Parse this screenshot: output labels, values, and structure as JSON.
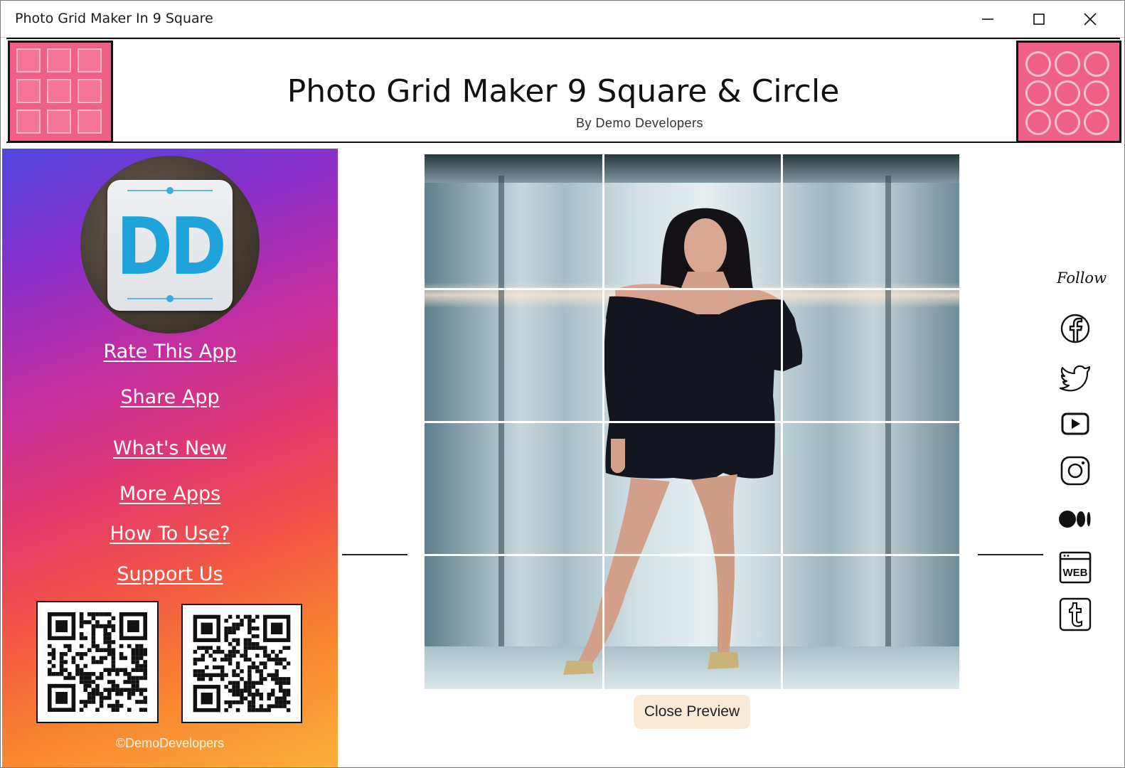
{
  "window": {
    "title": "Photo Grid Maker In 9 Square"
  },
  "header": {
    "title": "Photo Grid Maker 9 Square & Circle",
    "subtitle": "By  Demo  Developers"
  },
  "sidebar": {
    "avatar_text": "DD",
    "links": [
      {
        "id": "rate",
        "label": "Rate This App"
      },
      {
        "id": "share",
        "label": "Share App"
      },
      {
        "id": "whats-new",
        "label": "What's New"
      },
      {
        "id": "more-apps",
        "label": "More Apps"
      },
      {
        "id": "how-to-use",
        "label": "How To Use?"
      },
      {
        "id": "support",
        "label": "Support Us"
      }
    ],
    "copyright": "©DemoDevelopers"
  },
  "preview": {
    "grid": "3x4",
    "close_label": "Close Preview"
  },
  "follow": {
    "label": "Follow",
    "icons": [
      "facebook-icon",
      "twitter-icon",
      "youtube-icon",
      "instagram-icon",
      "medium-icon",
      "web-icon",
      "tumblr-icon"
    ],
    "web_text": "WEB"
  },
  "colors": {
    "accent_pink": "#ef5f86",
    "button_bg": "#fbe9d6",
    "gradient_top": "#5146e0",
    "gradient_bottom": "#fbb03b"
  }
}
